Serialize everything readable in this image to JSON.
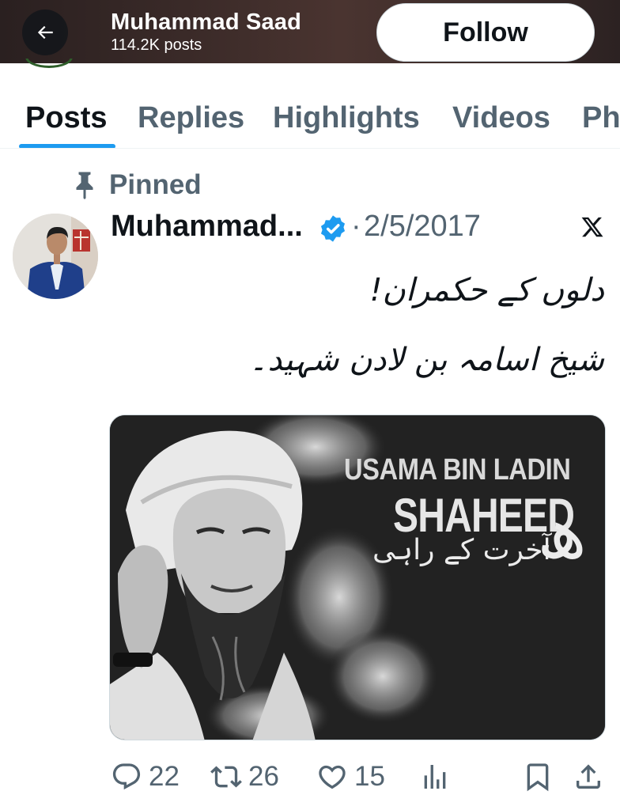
{
  "header": {
    "name": "Muhammad Saad",
    "post_count": "114.2K posts",
    "follow_label": "Follow"
  },
  "tabs": [
    {
      "label": "Posts",
      "active": true
    },
    {
      "label": "Replies",
      "active": false
    },
    {
      "label": "Highlights",
      "active": false
    },
    {
      "label": "Videos",
      "active": false
    },
    {
      "label": "Ph",
      "active": false
    }
  ],
  "tweet": {
    "pinned_label": "Pinned",
    "author": "Muhammad...",
    "separator": "·",
    "date": "2/5/2017",
    "text_lines": [
      "دلوں کے حکمران!",
      "شیخ اسامہ بن لادن شہید۔"
    ],
    "media": {
      "title_line1": "USAMA BIN LADIN",
      "title_line2": "SHAHEED",
      "urdu_caption": "آخرت کے راہی",
      "urdu_glyph": "ھ"
    },
    "actions": {
      "replies": "22",
      "reposts": "26",
      "likes": "15"
    }
  },
  "colors": {
    "accent": "#1d9bf0",
    "secondary_text": "#536471",
    "primary_text": "#0f1419"
  },
  "icons": [
    "back-arrow-icon",
    "pin-icon",
    "verified-badge-icon",
    "x-logo-icon",
    "reply-icon",
    "repost-icon",
    "like-icon",
    "views-icon",
    "bookmark-icon",
    "share-icon"
  ]
}
